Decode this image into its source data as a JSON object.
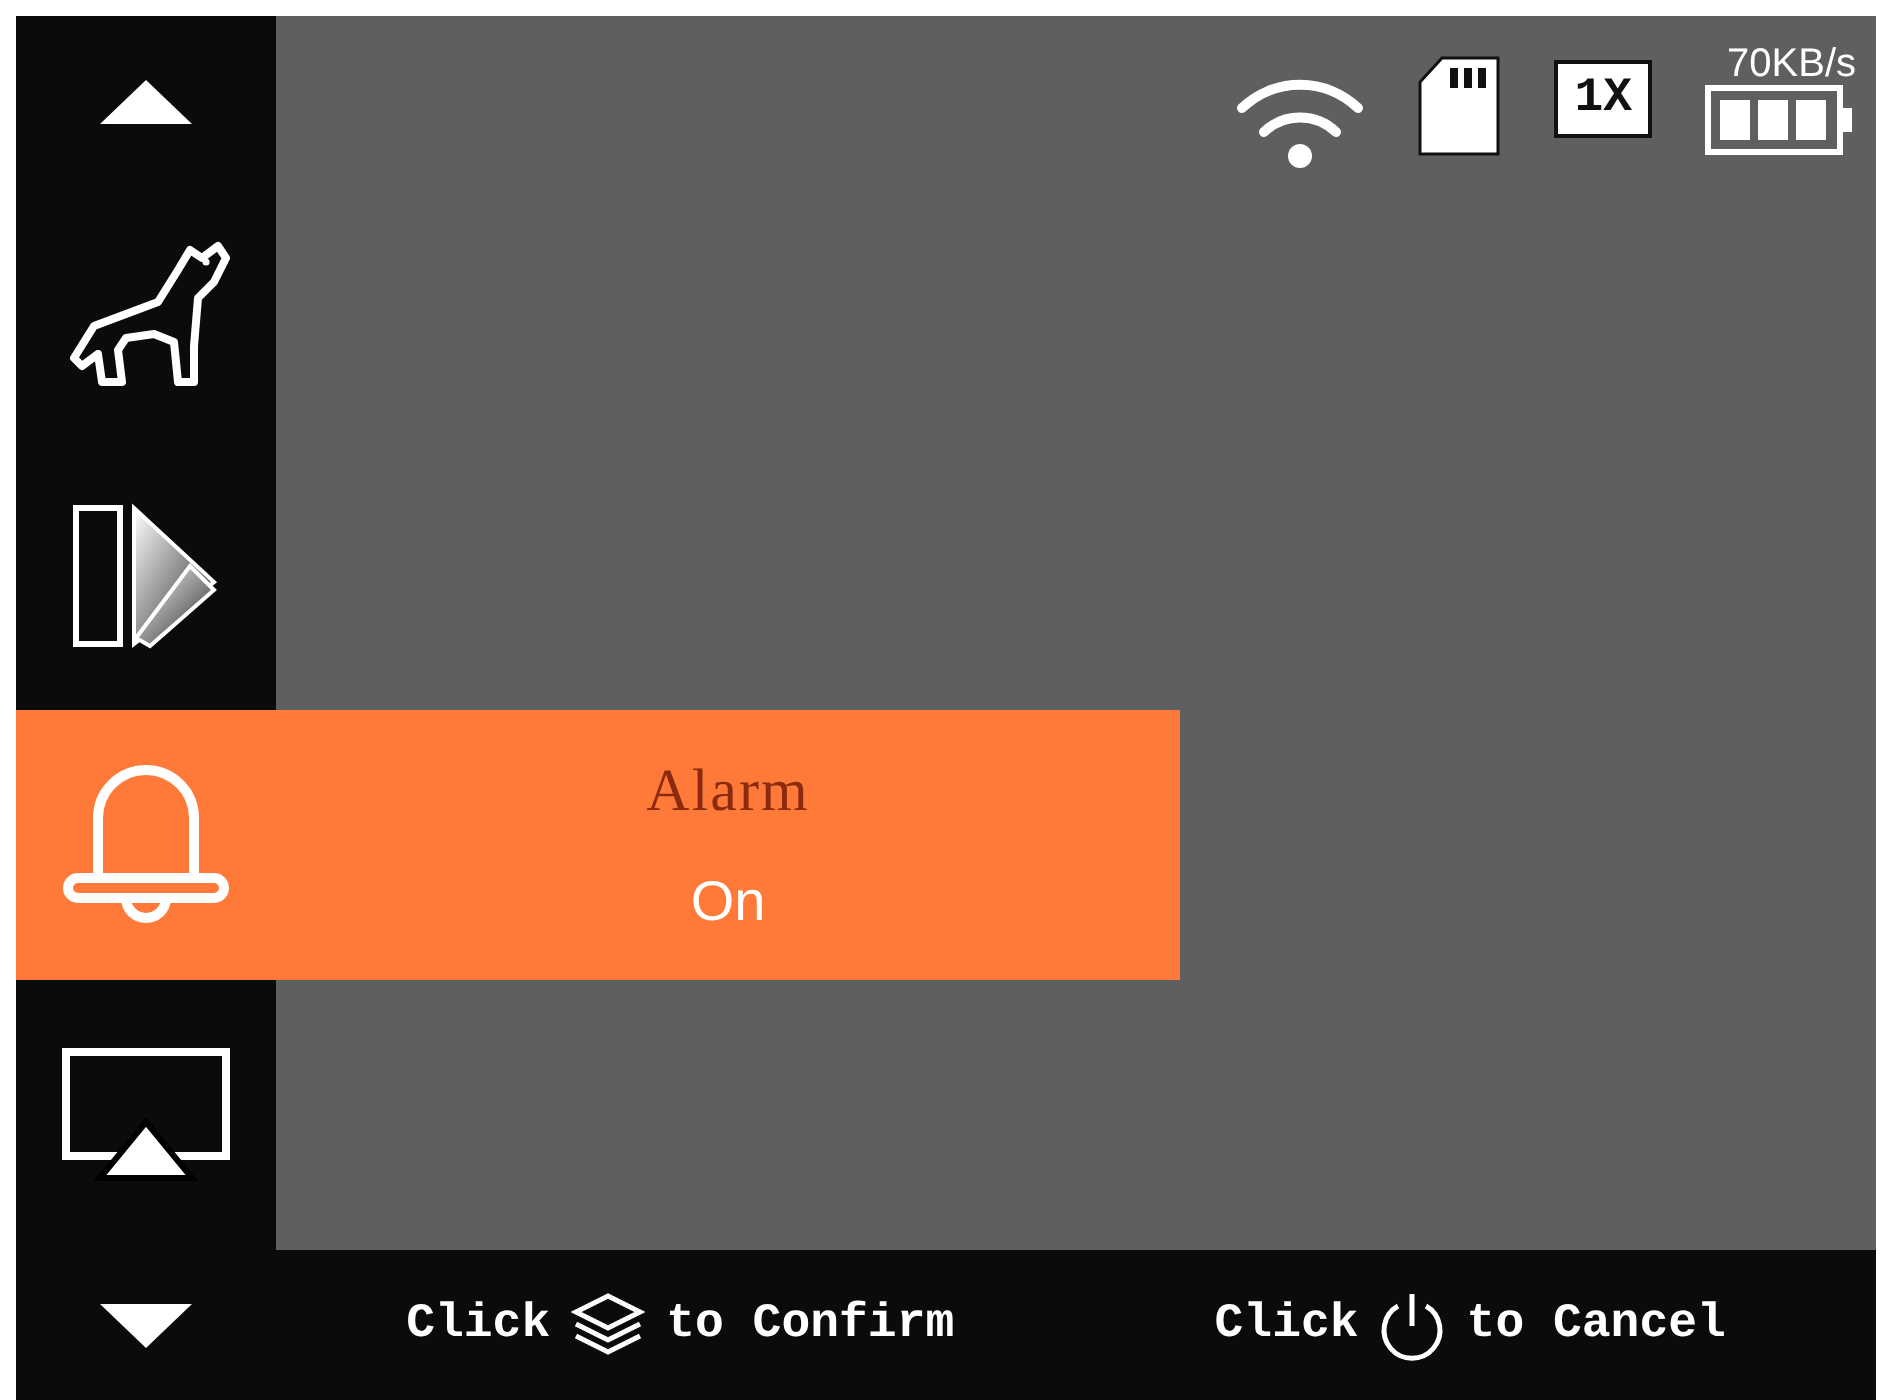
{
  "status_bar": {
    "speed": "70KB/s",
    "zoom": "1X"
  },
  "menu": [
    {
      "kind": "up"
    },
    {
      "kind": "hunt",
      "selected": false
    },
    {
      "kind": "palette",
      "selected": false
    },
    {
      "kind": "alarm",
      "selected": true,
      "title": "Alarm",
      "value": "On"
    },
    {
      "kind": "cast",
      "selected": false
    },
    {
      "kind": "down"
    }
  ],
  "hints": [
    {
      "kind": "confirm",
      "before": "Click",
      "after": "to Confirm"
    },
    {
      "kind": "cancel",
      "before": "Click",
      "after": "to Cancel"
    }
  ]
}
